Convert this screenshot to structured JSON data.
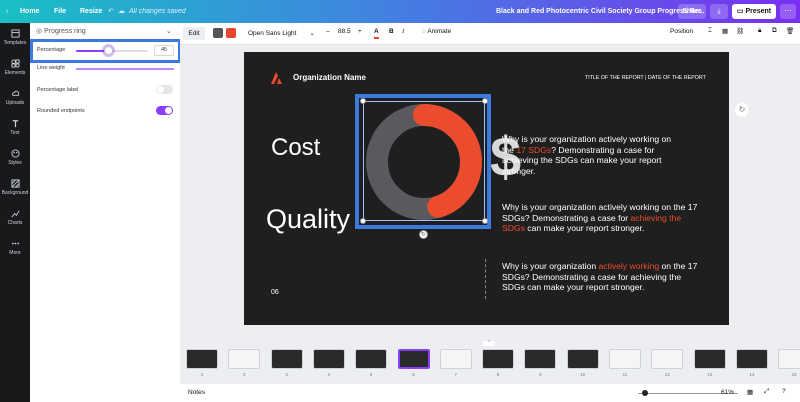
{
  "topbar": {
    "home": "Home",
    "file": "File",
    "resize": "Resize",
    "saved_status": "All changes saved",
    "doc_title": "Black and Red Photocentric Civil Society Group Progress Re...",
    "share": "Share",
    "present": "Present"
  },
  "rail": [
    {
      "label": "Templates",
      "icon": "template-icon"
    },
    {
      "label": "Elements",
      "icon": "elements-icon"
    },
    {
      "label": "Uploads",
      "icon": "upload-icon"
    },
    {
      "label": "Text",
      "icon": "text-icon"
    },
    {
      "label": "Styles",
      "icon": "styles-icon"
    },
    {
      "label": "Background",
      "icon": "background-icon"
    },
    {
      "label": "Charts",
      "icon": "charts-icon"
    },
    {
      "label": "More",
      "icon": "more-icon"
    }
  ],
  "panel": {
    "header": "Progress ring",
    "percentage_label": "Percentage",
    "percentage_value": "45",
    "percentage_fraction": 0.45,
    "line_weight_label": "Line weight",
    "percentage_toggle_label": "Percentage label",
    "percentage_toggle_on": false,
    "rounded_label": "Rounded endpoints",
    "rounded_on": true
  },
  "editbar": {
    "edit": "Edit",
    "color1": "#555555",
    "color2": "#e8452c",
    "font": "Open Sans Light",
    "size": "88.5",
    "animate": "Animate",
    "position": "Position"
  },
  "slide": {
    "org_name": "Organization Name",
    "report_meta": "TITLE OF THE REPORT | DATE OF THE REPORT",
    "cost": "Cost",
    "quality": "Quality",
    "page_num": "06",
    "dollar": "$",
    "ring_percent": 0.45,
    "ring_color": "#ea4c2d",
    "ring_track": "#5a5a5e",
    "p1": {
      "a": "Why is your organization actively working on the ",
      "b": "17 SDGs",
      "c": "? Demonstrating a case for achieving the SDGs can make your report stronger."
    },
    "p2": {
      "a": "Why is your organization actively working on the 17 SDGs? Demonstrating a case for ",
      "b": "achieving the SDGs",
      "c": " can make your report stronger."
    },
    "p3": {
      "a": "Why is your organization ",
      "b": "actively working",
      "c": " on the 17 SDGs? Demonstrating a case for achieving the SDGs can make your report stronger."
    }
  },
  "thumbnails": [
    "1",
    "2",
    "3",
    "4",
    "5",
    "6",
    "7",
    "8",
    "9",
    "10",
    "11",
    "12",
    "13",
    "14",
    "15"
  ],
  "footer": {
    "notes": "Notes",
    "zoom": "61%"
  },
  "accent": "#8b3dff"
}
